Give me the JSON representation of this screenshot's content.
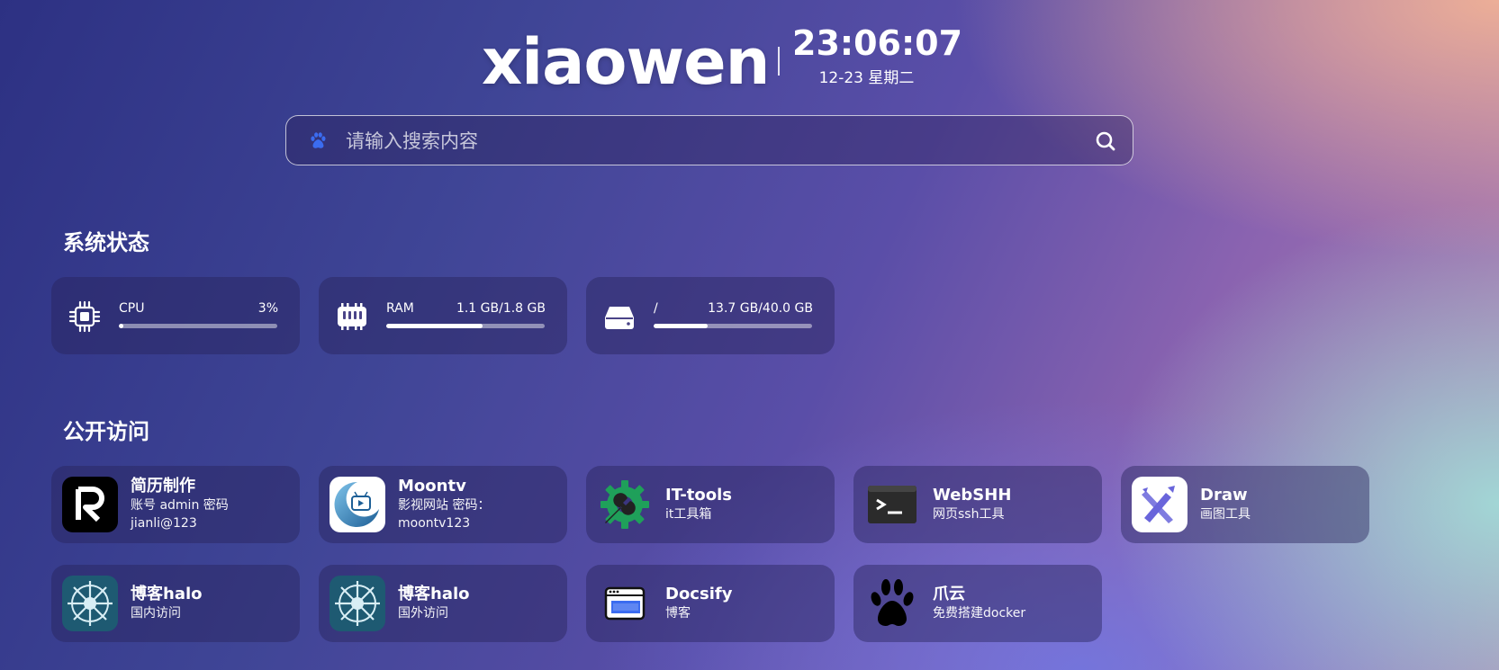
{
  "header": {
    "brand": "xiaowen",
    "time": "23:06:07",
    "date": "12-23 星期二"
  },
  "search": {
    "placeholder": "请输入搜索内容",
    "engine_icon": "baidu-paw-icon",
    "submit_icon": "search-icon"
  },
  "system": {
    "title": "系统状态",
    "stats": [
      {
        "label": "CPU",
        "value": "3%",
        "percent": 3,
        "icon": "cpu-icon"
      },
      {
        "label": "RAM",
        "value": "1.1 GB/1.8 GB",
        "percent": 61,
        "icon": "memory-icon"
      },
      {
        "label": "/",
        "value": "13.7 GB/40.0 GB",
        "percent": 34,
        "icon": "hard-drive-icon"
      }
    ]
  },
  "public": {
    "title": "公开访问",
    "apps": [
      {
        "name": "简历制作",
        "desc": "账号 admin 密码 jianli@123",
        "icon": "reactive-resume-logo"
      },
      {
        "name": "Moontv",
        "desc": "影视网站 密码：moontv123",
        "icon": "moontv-logo"
      },
      {
        "name": "IT-tools",
        "desc": "it工具箱",
        "icon": "gear-wrench-icon"
      },
      {
        "name": "WebSHH",
        "desc": "网页ssh工具",
        "icon": "terminal-icon"
      },
      {
        "name": "Draw",
        "desc": "画图工具",
        "icon": "excalidraw-logo"
      },
      {
        "name": "博客halo",
        "desc": "国内访问",
        "icon": "halo-logo"
      },
      {
        "name": "博客halo",
        "desc": "国外访问",
        "icon": "halo-logo"
      },
      {
        "name": "Docsify",
        "desc": "博客",
        "icon": "dotcom-browser-icon"
      },
      {
        "name": "爪云",
        "desc": "免费搭建docker",
        "icon": "paw-icon"
      }
    ]
  },
  "colors": {
    "accent_blue": "#3b6cf0",
    "it_tools_green": "#1fa05a",
    "draw_purple": "#6965db"
  }
}
